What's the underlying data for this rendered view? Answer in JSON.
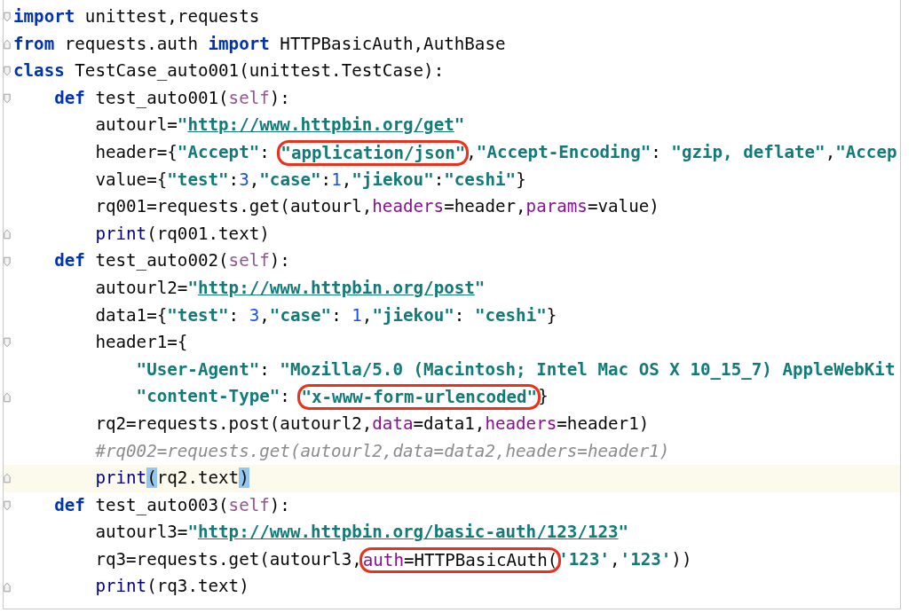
{
  "editor": {
    "lines": [
      {
        "fold_start": true,
        "fold_end": false,
        "current": false,
        "tokens": [
          {
            "kind": "kw",
            "text": "import"
          },
          {
            "kind": "plain",
            "text": " unittest,requests"
          }
        ]
      },
      {
        "fold_start": false,
        "fold_end": true,
        "current": false,
        "tokens": [
          {
            "kind": "kw",
            "text": "from"
          },
          {
            "kind": "plain",
            "text": " requests.auth "
          },
          {
            "kind": "kw",
            "text": "import"
          },
          {
            "kind": "plain",
            "text": " HTTPBasicAuth,AuthBase"
          }
        ]
      },
      {
        "fold_start": true,
        "fold_end": false,
        "current": false,
        "tokens": [
          {
            "kind": "kw",
            "text": "class"
          },
          {
            "kind": "plain",
            "text": " TestCase_auto001(unittest.TestCase):"
          }
        ],
        "children": [
          {
            "fold_start": true,
            "fold_end": false,
            "current": false,
            "tokens": [
              {
                "kind": "kw",
                "text": "def"
              },
              {
                "kind": "plain",
                "text": " test_auto001("
              },
              {
                "kind": "self",
                "text": "self"
              },
              {
                "kind": "plain",
                "text": "):"
              }
            ],
            "children": [
              {
                "fold_start": false,
                "fold_end": false,
                "current": false,
                "tokens": [
                  {
                    "kind": "plain",
                    "text": "autourl="
                  },
                  {
                    "kind": "str",
                    "text": "\""
                  },
                  {
                    "kind": "url",
                    "text": "http://www.httpbin.org/get"
                  },
                  {
                    "kind": "str",
                    "text": "\""
                  }
                ]
              },
              {
                "fold_start": false,
                "fold_end": false,
                "current": false,
                "tokens": [
                  {
                    "kind": "plain",
                    "text": "header={"
                  },
                  {
                    "kind": "str",
                    "text": "\"Accept\""
                  },
                  {
                    "kind": "plain",
                    "text": ": "
                  },
                  {
                    "kind": "circle",
                    "tokens": [
                      {
                        "kind": "str",
                        "text": "\"application/json\""
                      }
                    ]
                  },
                  {
                    "kind": "plain",
                    "text": ","
                  },
                  {
                    "kind": "str",
                    "text": "\"Accept-Encoding\""
                  },
                  {
                    "kind": "plain",
                    "text": ": "
                  },
                  {
                    "kind": "str",
                    "text": "\"gzip, deflate\""
                  },
                  {
                    "kind": "plain",
                    "text": ","
                  },
                  {
                    "kind": "str",
                    "text": "\"Accep"
                  }
                ]
              },
              {
                "fold_start": false,
                "fold_end": false,
                "current": false,
                "tokens": [
                  {
                    "kind": "plain",
                    "text": "value={"
                  },
                  {
                    "kind": "str",
                    "text": "\"test\""
                  },
                  {
                    "kind": "plain",
                    "text": ":"
                  },
                  {
                    "kind": "num",
                    "text": "3"
                  },
                  {
                    "kind": "plain",
                    "text": ","
                  },
                  {
                    "kind": "str",
                    "text": "\"case\""
                  },
                  {
                    "kind": "plain",
                    "text": ":"
                  },
                  {
                    "kind": "num",
                    "text": "1"
                  },
                  {
                    "kind": "plain",
                    "text": ","
                  },
                  {
                    "kind": "str",
                    "text": "\"jiekou\""
                  },
                  {
                    "kind": "plain",
                    "text": ":"
                  },
                  {
                    "kind": "str",
                    "text": "\"ceshi\""
                  },
                  {
                    "kind": "plain",
                    "text": "}"
                  }
                ]
              },
              {
                "fold_start": false,
                "fold_end": false,
                "current": false,
                "tokens": [
                  {
                    "kind": "plain",
                    "text": "rq001=requests.get(autourl,"
                  },
                  {
                    "kind": "param",
                    "text": "headers"
                  },
                  {
                    "kind": "plain",
                    "text": "=header,"
                  },
                  {
                    "kind": "param",
                    "text": "params"
                  },
                  {
                    "kind": "plain",
                    "text": "=value)"
                  }
                ]
              },
              {
                "fold_start": false,
                "fold_end": true,
                "current": false,
                "tokens": [
                  {
                    "kind": "builtin",
                    "text": "print"
                  },
                  {
                    "kind": "plain",
                    "text": "(rq001.text)"
                  }
                ]
              }
            ]
          },
          {
            "fold_start": true,
            "fold_end": false,
            "current": false,
            "tokens": [
              {
                "kind": "kw",
                "text": "def"
              },
              {
                "kind": "plain",
                "text": " test_auto002("
              },
              {
                "kind": "self",
                "text": "self"
              },
              {
                "kind": "plain",
                "text": "):"
              }
            ],
            "children": [
              {
                "fold_start": false,
                "fold_end": false,
                "current": false,
                "tokens": [
                  {
                    "kind": "plain",
                    "text": "autourl2="
                  },
                  {
                    "kind": "str",
                    "text": "\""
                  },
                  {
                    "kind": "url",
                    "text": "http://www.httpbin.org/post"
                  },
                  {
                    "kind": "str",
                    "text": "\""
                  }
                ]
              },
              {
                "fold_start": false,
                "fold_end": false,
                "current": false,
                "tokens": [
                  {
                    "kind": "plain",
                    "text": "data1={"
                  },
                  {
                    "kind": "str",
                    "text": "\"test\""
                  },
                  {
                    "kind": "plain",
                    "text": ": "
                  },
                  {
                    "kind": "num",
                    "text": "3"
                  },
                  {
                    "kind": "plain",
                    "text": ","
                  },
                  {
                    "kind": "str",
                    "text": "\"case\""
                  },
                  {
                    "kind": "plain",
                    "text": ": "
                  },
                  {
                    "kind": "num",
                    "text": "1"
                  },
                  {
                    "kind": "plain",
                    "text": ","
                  },
                  {
                    "kind": "str",
                    "text": "\"jiekou\""
                  },
                  {
                    "kind": "plain",
                    "text": ": "
                  },
                  {
                    "kind": "str",
                    "text": "\"ceshi\""
                  },
                  {
                    "kind": "plain",
                    "text": "}"
                  }
                ]
              },
              {
                "fold_start": true,
                "fold_end": false,
                "current": false,
                "tokens": [
                  {
                    "kind": "plain",
                    "text": "header1={"
                  }
                ],
                "children": [
                  {
                    "fold_start": false,
                    "fold_end": false,
                    "current": false,
                    "tokens": [
                      {
                        "kind": "str",
                        "text": "\"User-Agent\""
                      },
                      {
                        "kind": "plain",
                        "text": ": "
                      },
                      {
                        "kind": "str",
                        "text": "\"Mozilla/5.0 (Macintosh; Intel Mac OS X 10_15_7) AppleWebKit"
                      }
                    ]
                  },
                  {
                    "fold_start": false,
                    "fold_end": true,
                    "current": false,
                    "tokens": [
                      {
                        "kind": "str",
                        "text": "\"content-Type\""
                      },
                      {
                        "kind": "plain",
                        "text": ": "
                      },
                      {
                        "kind": "circle",
                        "tokens": [
                          {
                            "kind": "str",
                            "text": "\"x-www-form-urlencoded\""
                          }
                        ]
                      },
                      {
                        "kind": "plain",
                        "text": "}"
                      }
                    ]
                  }
                ]
              },
              {
                "fold_start": false,
                "fold_end": false,
                "current": false,
                "tokens": [
                  {
                    "kind": "plain",
                    "text": "rq2=requests.post(autourl2,"
                  },
                  {
                    "kind": "param",
                    "text": "data"
                  },
                  {
                    "kind": "plain",
                    "text": "=data1,"
                  },
                  {
                    "kind": "param",
                    "text": "headers"
                  },
                  {
                    "kind": "plain",
                    "text": "=header1)"
                  }
                ]
              },
              {
                "fold_start": false,
                "fold_end": false,
                "current": false,
                "tokens": [
                  {
                    "kind": "comment",
                    "text": "#rq002=requests.get(autourl2,data=data2,headers=header1)"
                  }
                ]
              },
              {
                "fold_start": false,
                "fold_end": true,
                "current": true,
                "tokens": [
                  {
                    "kind": "builtin",
                    "text": "print"
                  },
                  {
                    "kind": "match",
                    "text": "("
                  },
                  {
                    "kind": "plain",
                    "text": "rq2.text"
                  },
                  {
                    "kind": "match",
                    "text": ")"
                  }
                ]
              }
            ]
          },
          {
            "fold_start": true,
            "fold_end": false,
            "current": false,
            "tokens": [
              {
                "kind": "kw",
                "text": "def"
              },
              {
                "kind": "plain",
                "text": " test_auto003("
              },
              {
                "kind": "self",
                "text": "self"
              },
              {
                "kind": "plain",
                "text": "):"
              }
            ],
            "children": [
              {
                "fold_start": false,
                "fold_end": false,
                "current": false,
                "tokens": [
                  {
                    "kind": "plain",
                    "text": "autourl3="
                  },
                  {
                    "kind": "str",
                    "text": "\""
                  },
                  {
                    "kind": "url",
                    "text": "http://www.httpbin.org/basic-auth/123/123"
                  },
                  {
                    "kind": "str",
                    "text": "\""
                  }
                ]
              },
              {
                "fold_start": false,
                "fold_end": false,
                "current": false,
                "tokens": [
                  {
                    "kind": "plain",
                    "text": "rq3=requests.get(autourl3,"
                  },
                  {
                    "kind": "circle",
                    "tokens": [
                      {
                        "kind": "param",
                        "text": "auth"
                      },
                      {
                        "kind": "plain",
                        "text": "=HTTPBasicAuth("
                      }
                    ]
                  },
                  {
                    "kind": "str",
                    "text": "'123'"
                  },
                  {
                    "kind": "plain",
                    "text": ","
                  },
                  {
                    "kind": "str",
                    "text": "'123'"
                  },
                  {
                    "kind": "plain",
                    "text": "))"
                  }
                ]
              },
              {
                "fold_start": false,
                "fold_end": true,
                "current": false,
                "tokens": [
                  {
                    "kind": "builtin",
                    "text": "print"
                  },
                  {
                    "kind": "plain",
                    "text": "(rq3.text)"
                  }
                ]
              }
            ]
          }
        ]
      }
    ]
  }
}
